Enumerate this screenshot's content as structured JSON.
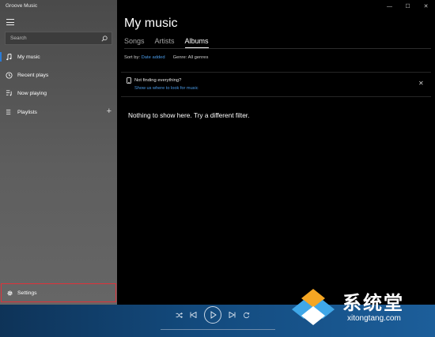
{
  "app": {
    "title": "Groove Music"
  },
  "window_controls": {
    "minimize": "—",
    "maximize": "☐",
    "close": "✕"
  },
  "search": {
    "placeholder": "Search"
  },
  "sidebar": {
    "items": [
      {
        "label": "My music",
        "icon": "music-note-icon",
        "active": true
      },
      {
        "label": "Recent plays",
        "icon": "clock-icon"
      },
      {
        "label": "Now playing",
        "icon": "now-playing-icon"
      },
      {
        "label": "Playlists",
        "icon": "playlist-icon"
      }
    ],
    "add_playlist": "+",
    "settings": {
      "label": "Settings",
      "icon": "gear-icon",
      "highlight_color": "#e0313a"
    }
  },
  "main": {
    "title": "My music",
    "tabs": [
      {
        "label": "Songs"
      },
      {
        "label": "Artists"
      },
      {
        "label": "Albums",
        "active": true
      }
    ],
    "sort": {
      "label": "Sort by:",
      "value": "Date added"
    },
    "genre": {
      "label": "Genre:",
      "value": "All genres"
    },
    "notice": {
      "title": "Not finding everything?",
      "link": "Show us where to look for music",
      "close": "✕"
    },
    "empty_message": "Nothing to show here. Try a different filter."
  },
  "player": {
    "controls": [
      "shuffle-icon",
      "previous-icon",
      "play-icon",
      "next-icon",
      "repeat-icon"
    ]
  },
  "watermark": {
    "text_cn": "系统堂",
    "url": "xitongtang.com"
  },
  "colors": {
    "accent": "#2a7bd6",
    "link": "#4a9be8",
    "player_bar": "#134a7d"
  }
}
